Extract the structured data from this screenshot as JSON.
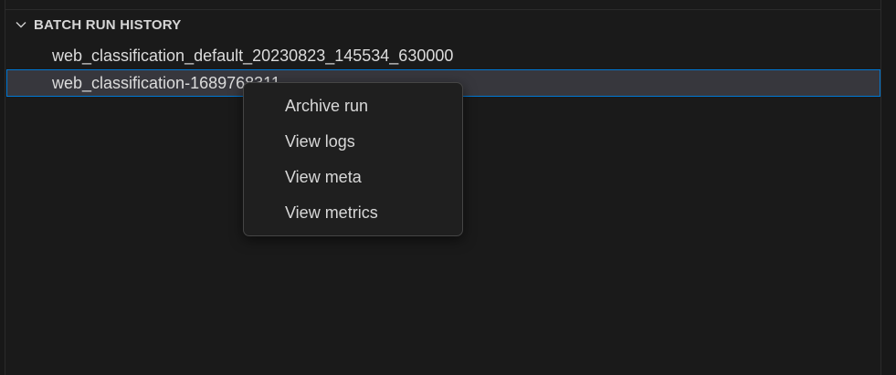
{
  "section": {
    "title": "BATCH RUN HISTORY",
    "chevron_icon": "chevron-down-icon"
  },
  "runs": [
    {
      "label": "web_classification_default_20230823_145534_630000"
    },
    {
      "label": "web_classification-1689768311"
    }
  ],
  "context_menu": {
    "items": [
      {
        "label": "Archive run"
      },
      {
        "label": "View logs"
      },
      {
        "label": "View meta"
      },
      {
        "label": "View metrics"
      }
    ]
  },
  "colors": {
    "background": "#1a1a1a",
    "selection_bg": "#37373d",
    "focus_border": "#0078d4",
    "menu_bg": "#1f1f1f"
  }
}
